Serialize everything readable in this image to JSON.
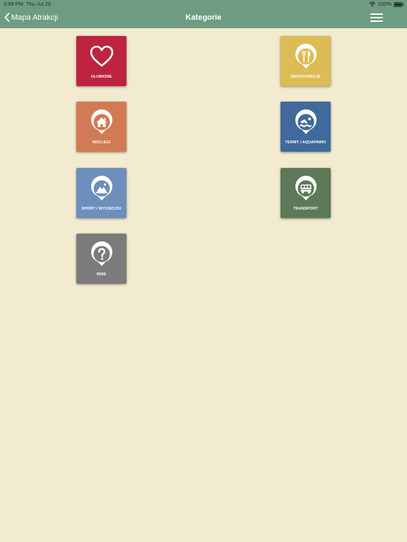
{
  "status_bar": {
    "time": "3:59 PM",
    "date": "Thu Jul 25",
    "battery": "100%"
  },
  "nav": {
    "back_label": "Mapa Atrakcji",
    "title": "Kategorie"
  },
  "categories": [
    {
      "label": "ULUBIONE",
      "icon": "heart-icon",
      "color": "#bd2440"
    },
    {
      "label": "RESTAURACJE",
      "icon": "fork-knife-icon",
      "color": "#ddbc55"
    },
    {
      "label": "NOCLEGI",
      "icon": "house-icon",
      "color": "#d27a54"
    },
    {
      "label": "TERMY / AQUAPARKI",
      "icon": "swimmer-icon",
      "color": "#3f6a9b"
    },
    {
      "label": "SPORT / WYCIECZKI",
      "icon": "mountain-icon",
      "color": "#6d8fbc"
    },
    {
      "label": "TRANSPORT",
      "icon": "bus-icon",
      "color": "#5c7958"
    },
    {
      "label": "INNE",
      "icon": "question-icon",
      "color": "#7b7b7b"
    }
  ],
  "colors": {
    "nav_background": "#6e9c83",
    "page_background": "#f2ebd0"
  }
}
